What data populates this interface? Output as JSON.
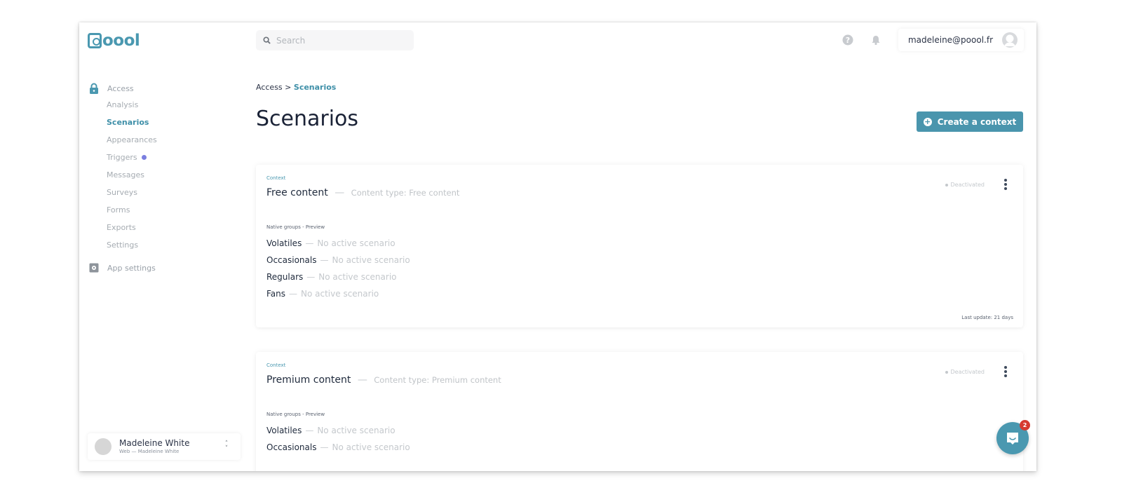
{
  "app": {
    "logo_text": "oool",
    "brand_color": "#4a98b0"
  },
  "search": {
    "placeholder": "Search",
    "value": "",
    "icon": "search-icon"
  },
  "topbar": {
    "help_icon": "question-circle-icon",
    "notifications_icon": "bell-icon",
    "account_email": "madeleine@poool.fr",
    "avatar_icon": "user-avatar-icon"
  },
  "sidebar": {
    "access": {
      "label": "Access",
      "icon": "lock-icon",
      "items": [
        {
          "label": "Analysis",
          "active": false
        },
        {
          "label": "Scenarios",
          "active": true
        },
        {
          "label": "Appearances",
          "active": false
        },
        {
          "label": "Triggers",
          "active": false,
          "dot": true,
          "dot_color": "#7b7fe0"
        },
        {
          "label": "Messages",
          "active": false
        },
        {
          "label": "Surveys",
          "active": false
        },
        {
          "label": "Forms",
          "active": false
        },
        {
          "label": "Exports",
          "active": false
        },
        {
          "label": "Settings",
          "active": false
        }
      ]
    },
    "app_settings": {
      "label": "App settings",
      "icon": "gear-icon"
    },
    "user_switcher": {
      "name": "Madeleine White",
      "subtitle": "Web — Madeleine White"
    }
  },
  "main": {
    "breadcrumb": {
      "parent": "Access",
      "separator": ">",
      "current": "Scenarios"
    },
    "title": "Scenarios",
    "create_button_label": "Create a context",
    "contexts": [
      {
        "label": "Context",
        "name": "Free content",
        "separator": "—",
        "content_type": "Content type: Free content",
        "status": "Deactivated",
        "groups_label": "Native groups - Preview",
        "groups": [
          {
            "name": "Volatiles",
            "status": "No active scenario"
          },
          {
            "name": "Occasionals",
            "status": "No active scenario"
          },
          {
            "name": "Regulars",
            "status": "No active scenario"
          },
          {
            "name": "Fans",
            "status": "No active scenario"
          }
        ],
        "last_update": "Last update: 21 days"
      },
      {
        "label": "Context",
        "name": "Premium content",
        "separator": "—",
        "content_type": "Content type: Premium content",
        "status": "Deactivated",
        "groups_label": "Native groups - Preview",
        "groups": [
          {
            "name": "Volatiles",
            "status": "No active scenario"
          },
          {
            "name": "Occasionals",
            "status": "No active scenario"
          }
        ]
      }
    ]
  },
  "chat": {
    "unread_count": "2",
    "icon": "chat-bubble-icon"
  }
}
